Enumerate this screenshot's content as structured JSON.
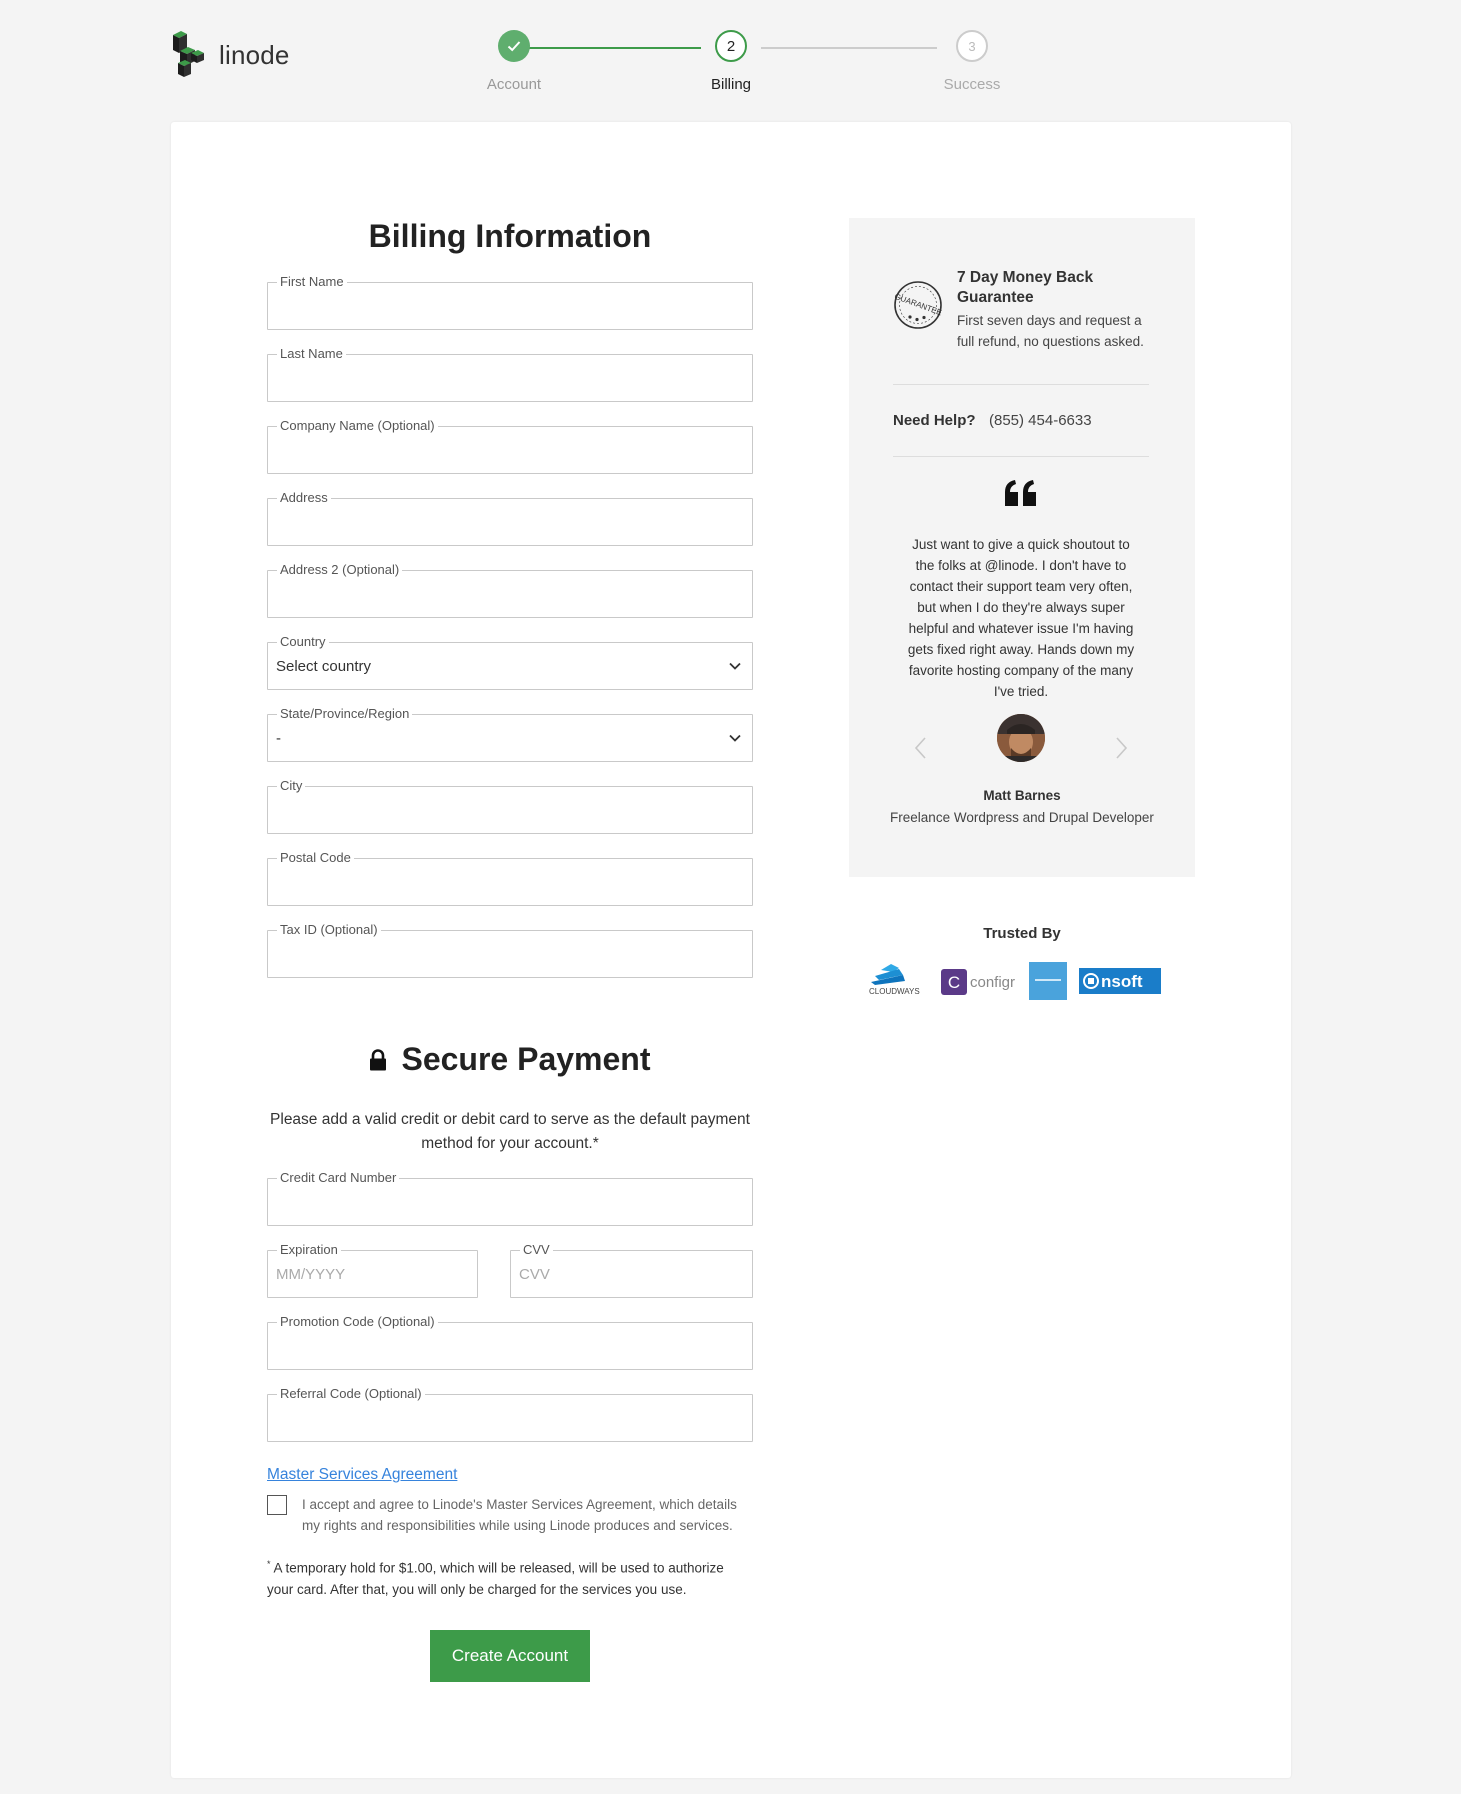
{
  "brand": {
    "name": "linode"
  },
  "stepper": {
    "steps": [
      {
        "label": "Account",
        "number": "1",
        "state": "complete"
      },
      {
        "label": "Billing",
        "number": "2",
        "state": "active"
      },
      {
        "label": "Success",
        "number": "3",
        "state": "pending"
      }
    ]
  },
  "billing": {
    "title": "Billing Information",
    "fields": {
      "first_name": {
        "label": "First Name",
        "value": ""
      },
      "last_name": {
        "label": "Last Name",
        "value": ""
      },
      "company": {
        "label": "Company Name (Optional)",
        "value": ""
      },
      "address": {
        "label": "Address",
        "value": ""
      },
      "address2": {
        "label": "Address 2 (Optional)",
        "value": ""
      },
      "country": {
        "label": "Country",
        "value": "Select country"
      },
      "state": {
        "label": "State/Province/Region",
        "value": "-"
      },
      "city": {
        "label": "City",
        "value": ""
      },
      "postal": {
        "label": "Postal Code",
        "value": ""
      },
      "tax_id": {
        "label": "Tax ID (Optional)",
        "value": ""
      }
    }
  },
  "payment": {
    "title": "Secure Payment",
    "description": "Please add a valid credit or debit card to serve as the default payment method for your account.*",
    "fields": {
      "card_number": {
        "label": "Credit Card Number",
        "value": ""
      },
      "expiration": {
        "label": "Expiration",
        "placeholder": "MM/YYYY"
      },
      "cvv": {
        "label": "CVV",
        "placeholder": "CVV"
      },
      "promo": {
        "label": "Promotion Code (Optional)",
        "value": ""
      },
      "referral": {
        "label": "Referral Code (Optional)",
        "value": ""
      }
    },
    "msa_link": "Master Services Agreement",
    "accept_text": "I accept and agree to Linode's Master Services Agreement, which details my rights and responsibilities while using Linode produces and services.",
    "accepted": false,
    "hold_mark": "*",
    "hold_text": " A temporary hold for $1.00, which will be released, will be used to authorize your card. After that, you will only be charged for the services you use.",
    "submit_label": "Create Account"
  },
  "sidebar": {
    "guarantee": {
      "title": "7 Day Money Back Guarantee",
      "text": "First seven days and request a full refund, no questions asked.",
      "seal_text": "GUARANTEE"
    },
    "help": {
      "label": "Need Help?",
      "phone": "(855) 454-6633"
    },
    "testimonial": {
      "quote": "Just want to give a quick shoutout to the folks at @linode. I don't have to contact their support team very often, but when I do they're always super helpful and whatever issue I'm having gets fixed right away. Hands down my favorite hosting company of the many I've tried.",
      "name": "Matt Barnes",
      "role": "Freelance Wordpress and Drupal Developer"
    }
  },
  "trusted": {
    "title": "Trusted By",
    "logos": [
      {
        "name": "cloudways",
        "text": "CLOUDWAYS"
      },
      {
        "name": "configr",
        "text": "configr"
      },
      {
        "name": "unknown-blue-logo",
        "text": ""
      },
      {
        "name": "nsoft",
        "text": "nsoft"
      }
    ]
  },
  "colors": {
    "accent_green": "#3d9b49",
    "complete_green": "#5fae6e",
    "link_blue": "#3683dc",
    "background": "#f4f4f4"
  }
}
